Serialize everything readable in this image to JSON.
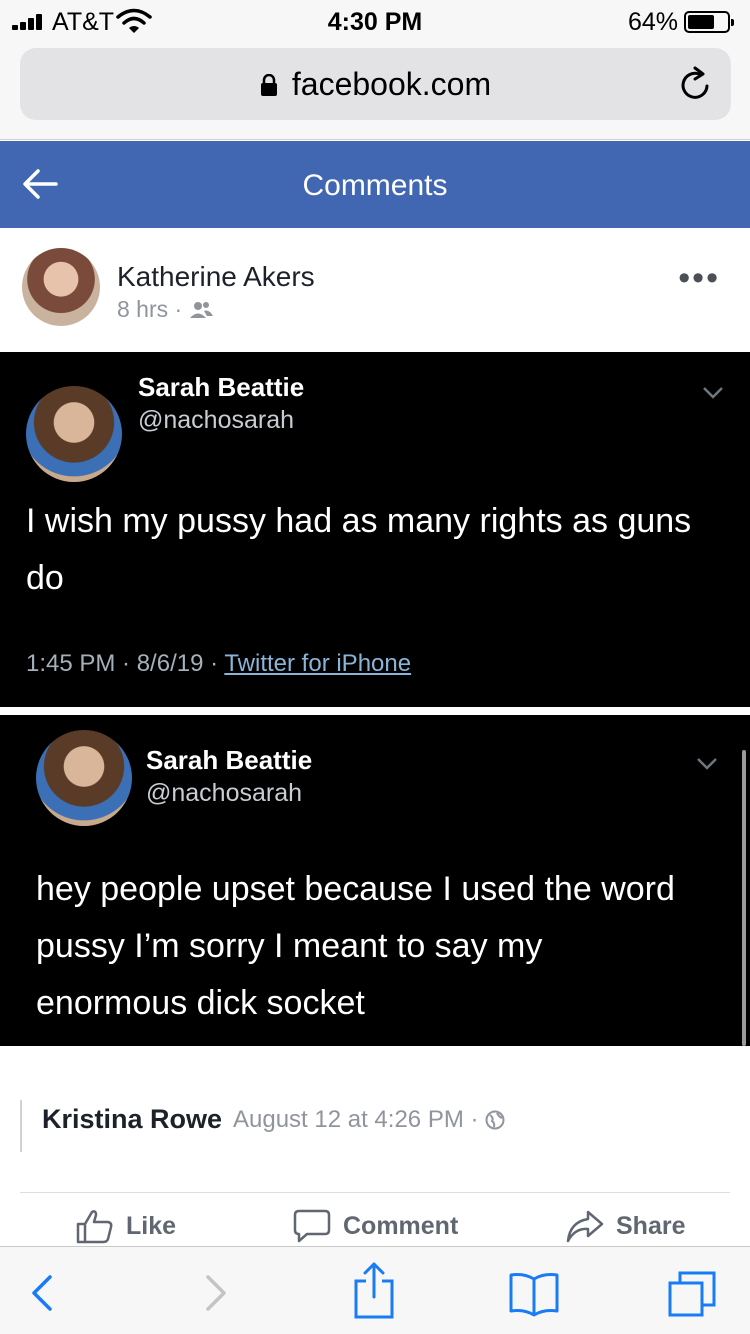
{
  "status": {
    "carrier": "AT&T",
    "time": "4:30 PM",
    "battery_pct": "64%"
  },
  "browser": {
    "url": "facebook.com"
  },
  "header": {
    "title": "Comments"
  },
  "post": {
    "author": "Katherine Akers",
    "age": "8 hrs ·"
  },
  "tweets": [
    {
      "name": "Sarah Beattie",
      "handle": "@nachosarah",
      "text": "I wish my pussy had as many rights as guns do",
      "time": "1:45 PM · 8/6/19 · ",
      "source": "Twitter for iPhone"
    },
    {
      "name": "Sarah Beattie",
      "handle": "@nachosarah",
      "text": "hey people upset because I used the word pussy I’m sorry I meant to say my enormous dick socket"
    }
  ],
  "comment": {
    "author": "Kristina Rowe",
    "date": "August 12 at 4:26 PM ·"
  },
  "actions": {
    "like": "Like",
    "comment": "Comment",
    "share": "Share"
  },
  "colors": {
    "facebook_blue": "#4267b2",
    "safari_blue": "#1a7cf4"
  }
}
